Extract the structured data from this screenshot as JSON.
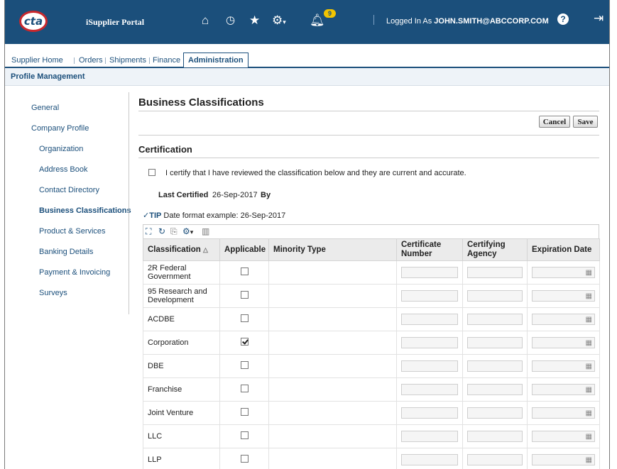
{
  "header": {
    "logo_text": "cta",
    "portal_title": "iSupplier Portal",
    "notification_count": "9",
    "logged_in_prefix": "Logged In As",
    "user": "JOHN.SMITH@ABCCORP.COM"
  },
  "tabs": [
    {
      "label": "Supplier Home"
    },
    {
      "label": "Orders"
    },
    {
      "label": "Shipments"
    },
    {
      "label": "Finance"
    },
    {
      "label": "Administration"
    }
  ],
  "subnav": {
    "title": "Profile Management"
  },
  "sidebar": {
    "items": [
      {
        "label": "General"
      },
      {
        "label": "Company Profile"
      },
      {
        "label": "Organization"
      },
      {
        "label": "Address Book"
      },
      {
        "label": "Contact Directory"
      },
      {
        "label": "Business Classifications"
      },
      {
        "label": "Product & Services"
      },
      {
        "label": "Banking Details"
      },
      {
        "label": "Payment & Invoicing"
      },
      {
        "label": "Surveys"
      }
    ]
  },
  "page": {
    "title": "Business Classifications",
    "cancel_label": "Cancel",
    "save_label": "Save",
    "certification": {
      "section_title": "Certification",
      "certify_text": "I certify that I have reviewed the classification below and they are current and accurate.",
      "last_certified_label": "Last Certified",
      "last_certified_value": "26-Sep-2017",
      "by_label": "By"
    },
    "tip_label": "TIP",
    "tip_text": "Date format example: 26-Sep-2017"
  },
  "table": {
    "columns": [
      "Classification",
      "Applicable",
      "Minority Type",
      "Certificate Number",
      "Certifying Agency",
      "Expiration Date"
    ],
    "rows": [
      {
        "classification": "2R Federal Government",
        "applicable": false
      },
      {
        "classification": "95 Research and Development",
        "applicable": false
      },
      {
        "classification": "ACDBE",
        "applicable": false
      },
      {
        "classification": "Corporation",
        "applicable": true
      },
      {
        "classification": "DBE",
        "applicable": false
      },
      {
        "classification": "Franchise",
        "applicable": false
      },
      {
        "classification": "Joint Venture",
        "applicable": false
      },
      {
        "classification": "LLC",
        "applicable": false
      },
      {
        "classification": "LLP",
        "applicable": false
      }
    ]
  }
}
